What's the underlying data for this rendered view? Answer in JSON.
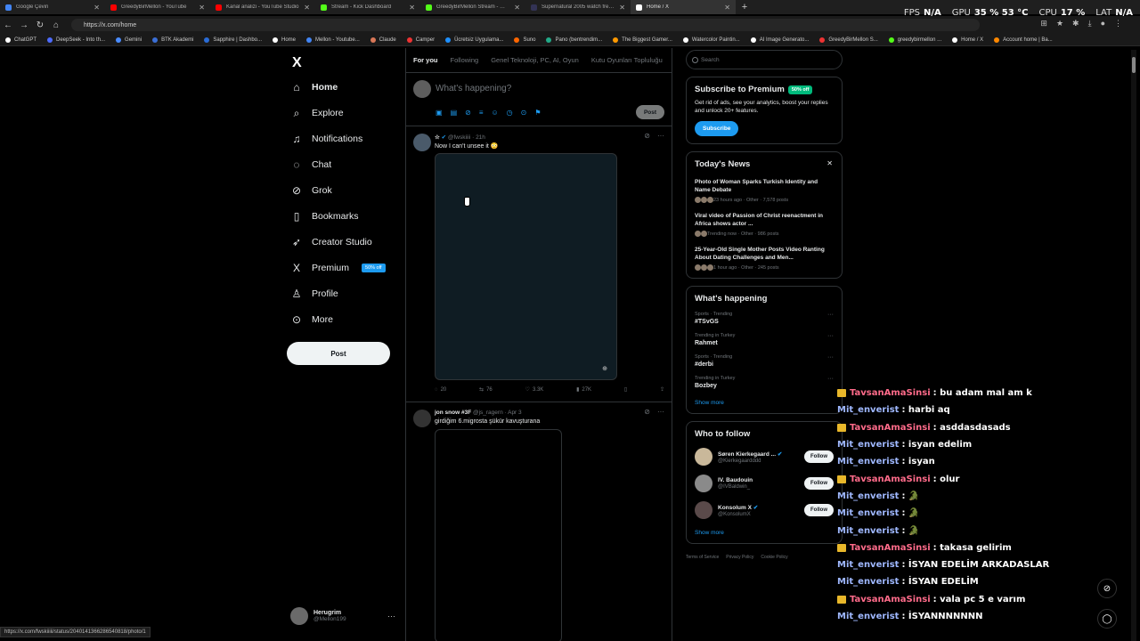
{
  "browser": {
    "tabs": [
      {
        "label": "Google Çeviri",
        "color": "#4285f4",
        "active": false
      },
      {
        "label": "GreedyBirMellon - YouTube",
        "color": "#ff0000",
        "active": false
      },
      {
        "label": "Kanal analizi - YouTube Studio",
        "color": "#ff0000",
        "active": false
      },
      {
        "label": "Stream - Kick Dashboard",
        "color": "#53fc18",
        "active": false
      },
      {
        "label": "GreedyBirMellon Stream - Watch Live",
        "color": "#53fc18",
        "active": false
      },
      {
        "label": "Supernatural 2005 watch free - 1",
        "color": "#335",
        "active": false
      },
      {
        "label": "Home / X",
        "color": "#ffffff",
        "active": true
      }
    ],
    "new_tab": "+",
    "url": "https://x.com/home",
    "bookmarks": [
      {
        "label": "ChatGPT",
        "color": "#fff"
      },
      {
        "label": "DeepSeek - Into th...",
        "color": "#4d6bfe"
      },
      {
        "label": "Gemini",
        "color": "#4a8cff"
      },
      {
        "label": "BTK Akademi",
        "color": "#3b6fd6"
      },
      {
        "label": "Sapphire | Dashbo...",
        "color": "#2a6cd6"
      },
      {
        "label": "Home",
        "color": "#fff"
      },
      {
        "label": "Mellon - Youtube...",
        "color": "#4285f4"
      },
      {
        "label": "Claude",
        "color": "#d97757"
      },
      {
        "label": "Camper",
        "color": "#e33"
      },
      {
        "label": "Ücretsiz Uygulama...",
        "color": "#1e90ff"
      },
      {
        "label": "Suno",
        "color": "#f60"
      },
      {
        "label": "Pano (bentrendim...",
        "color": "#2a8"
      },
      {
        "label": "The Biggest Gamer...",
        "color": "#f90"
      },
      {
        "label": "Watercolor Paintin...",
        "color": "#fff"
      },
      {
        "label": "AI Image Generato...",
        "color": "#fff"
      },
      {
        "label": "GreedyBirMellon S...",
        "color": "#e33"
      },
      {
        "label": "greedybirmellon ...",
        "color": "#53fc18"
      },
      {
        "label": "Home / X",
        "color": "#fff"
      },
      {
        "label": "Account home | Ba...",
        "color": "#f80"
      }
    ],
    "status_url": "https://x.com/fwskiiiii/status/2040141366286540818/photo/1"
  },
  "osd": {
    "fps_label": "FPS",
    "fps_value": "N/A",
    "gpu_label": "GPU",
    "gpu_value": "35 % 53 °C",
    "cpu_label": "CPU",
    "cpu_value": "17 %",
    "lat_label": "LAT",
    "lat_value": "N/A"
  },
  "nav": {
    "logo": "X",
    "items": [
      {
        "label": "Home",
        "icon": "house-icon",
        "glyph": "⌂"
      },
      {
        "label": "Explore",
        "icon": "search-icon",
        "glyph": "⌕"
      },
      {
        "label": "Notifications",
        "icon": "bell-icon",
        "glyph": "♫"
      },
      {
        "label": "Chat",
        "icon": "chat-icon",
        "glyph": "◌"
      },
      {
        "label": "Grok",
        "icon": "grok-icon",
        "glyph": "⊘"
      },
      {
        "label": "Bookmarks",
        "icon": "bookmark-icon",
        "glyph": "▯"
      },
      {
        "label": "Creator Studio",
        "icon": "rocket-icon",
        "glyph": "➶"
      },
      {
        "label": "Premium",
        "icon": "x-logo-icon",
        "glyph": "X"
      },
      {
        "label": "Profile",
        "icon": "person-icon",
        "glyph": "♙"
      },
      {
        "label": "More",
        "icon": "more-circle-icon",
        "glyph": "⊙"
      }
    ],
    "premium_badge": "50% off",
    "post_label": "Post",
    "account_name": "Herugrim",
    "account_handle": "@Mellon199",
    "account_more": "···"
  },
  "timeline": {
    "tabs": [
      "For you",
      "Following",
      "Genel Teknoloji, PC, AI, Oyun",
      "Kutu Oyunları Topluluğu"
    ],
    "composer_placeholder": "What's happening?",
    "composer_post": "Post",
    "tweets": [
      {
        "name": "☆",
        "handle": "@fwskiiii",
        "time": "· 21h",
        "text": "Now I can't unsee it 😳",
        "replies": "20",
        "reposts": "76",
        "likes": "3.3K",
        "views": "27K"
      },
      {
        "name": "jon snow #3F",
        "handle": "@js_ragern",
        "time": "· Apr 3",
        "text": "girdiğim 6.migrosta şükür kavuşturana"
      }
    ]
  },
  "sidebar": {
    "search_placeholder": "Search",
    "premium": {
      "title": "Subscribe to Premium",
      "badge": "50% off",
      "body": "Get rid of ads, see your analytics, boost your replies and unlock 20+ features.",
      "button": "Subscribe"
    },
    "news": {
      "title": "Today's News",
      "close": "✕",
      "items": [
        {
          "title": "Photo of Woman Sparks Turkish Identity and Name Debate",
          "meta": "23 hours ago · Other · 7,578 posts"
        },
        {
          "title": "Viral video of Passion of Christ reenactment in Africa shows actor ...",
          "meta": "Trending now · Other · 986 posts"
        },
        {
          "title": "25-Year-Old Single Mother Posts Video Ranting About Dating Challenges and Men...",
          "meta": "1 hour ago · Other · 245 posts"
        }
      ]
    },
    "happening": {
      "title": "What's happening",
      "items": [
        {
          "context": "Sports · Trending",
          "name": "#TSvGS"
        },
        {
          "context": "Trending in Turkey",
          "name": "Rahmet"
        },
        {
          "context": "Sports · Trending",
          "name": "#derbi"
        },
        {
          "context": "Trending in Turkey",
          "name": "Bozbey"
        }
      ],
      "show_more": "Show more"
    },
    "who_to_follow": {
      "title": "Who to follow",
      "items": [
        {
          "name": "Søren Kierkegaard ...",
          "handle": "@Kierkegaardddd",
          "button": "Follow"
        },
        {
          "name": "IV. Baudouin",
          "handle": "@IVBaldwin_",
          "button": "Follow"
        },
        {
          "name": "Konsolum X",
          "handle": "@KonsolumX",
          "button": "Follow"
        }
      ],
      "show_more": "Show more"
    },
    "footer": [
      "Terms of Service",
      "Privacy Policy",
      "Cookie Policy"
    ]
  },
  "chat": [
    {
      "user": "TavsanAmaSinsi",
      "text": ": bu adam mal am k",
      "badge": true
    },
    {
      "user": "Mit_enverist",
      "text": ": harbi aq",
      "badge": false
    },
    {
      "user": "TavsanAmaSinsi",
      "text": ": asddasdasads",
      "badge": true
    },
    {
      "user": "Mit_enverist",
      "text": ": isyan edelim",
      "badge": false
    },
    {
      "user": "Mit_enverist",
      "text": ": isyan",
      "badge": false
    },
    {
      "user": "TavsanAmaSinsi",
      "text": ": olur",
      "badge": true
    },
    {
      "user": "Mit_enverist",
      "text": ": 🐊",
      "badge": false
    },
    {
      "user": "Mit_enverist",
      "text": ": 🐊",
      "badge": false
    },
    {
      "user": "Mit_enverist",
      "text": ": 🐊",
      "badge": false
    },
    {
      "user": "TavsanAmaSinsi",
      "text": ": takasa gelirim",
      "badge": true
    },
    {
      "user": "Mit_enverist",
      "text": ": İSYAN EDELİM ARKADASLAR",
      "badge": false
    },
    {
      "user": "Mit_enverist",
      "text": ": İSYAN EDELİM",
      "badge": false
    },
    {
      "user": "TavsanAmaSinsi",
      "text": ": vala pc 5 e varım",
      "badge": true
    },
    {
      "user": "Mit_enverist",
      "text": ": İSYANNNNNNN",
      "badge": false
    }
  ]
}
